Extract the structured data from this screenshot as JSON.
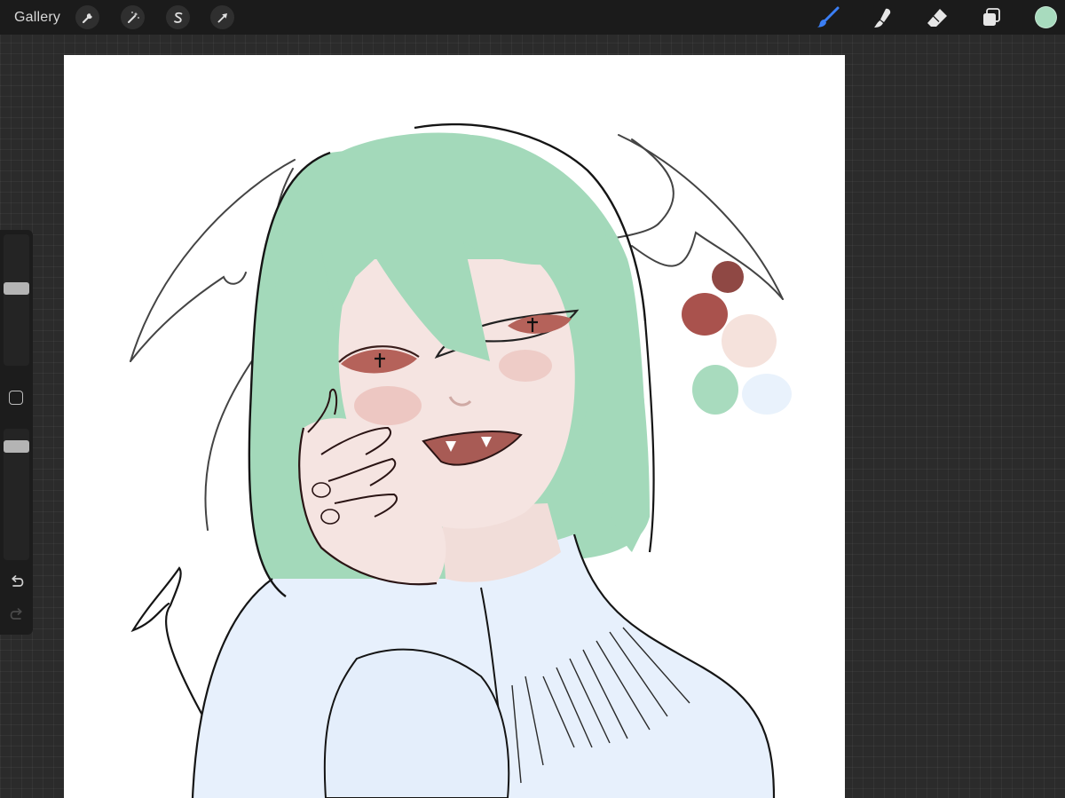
{
  "topbar": {
    "gallery_label": "Gallery",
    "left_tools": [
      {
        "name": "actions",
        "icon": "wrench-icon"
      },
      {
        "name": "adjustments",
        "icon": "magic-wand-icon"
      },
      {
        "name": "selection",
        "icon": "selection-s-icon"
      },
      {
        "name": "transform",
        "icon": "arrow-cursor-icon"
      }
    ],
    "right_tools": [
      {
        "name": "brush",
        "icon": "brush-icon",
        "active": true
      },
      {
        "name": "smudge",
        "icon": "smudge-finger-icon",
        "active": false
      },
      {
        "name": "eraser",
        "icon": "eraser-icon",
        "active": false
      },
      {
        "name": "layers",
        "icon": "layers-icon",
        "active": false
      }
    ],
    "current_color": "#a8dbbe"
  },
  "sidebar": {
    "brush_size_level": 0.6,
    "opacity_level": 0.9,
    "modify_icon": "square-outline-icon",
    "undo_icon": "undo-icon",
    "redo_icon": "redo-icon",
    "redo_enabled": false
  },
  "colors": {
    "accent": "#3b7ff5",
    "topbar_bg": "#1b1b1b",
    "hair": "#a3d9ba",
    "skin": "#f5e4e1",
    "blush": "#e7b4ae",
    "eye": "#b5625a",
    "lips": "#a85b55",
    "sweater": "#e7f0fc",
    "lineart": "#1a1a1a"
  },
  "palette_swatches": [
    "#8f4844",
    "#a9524d",
    "#f5e2dc",
    "#a8dbbe",
    "#e9f2fc"
  ]
}
